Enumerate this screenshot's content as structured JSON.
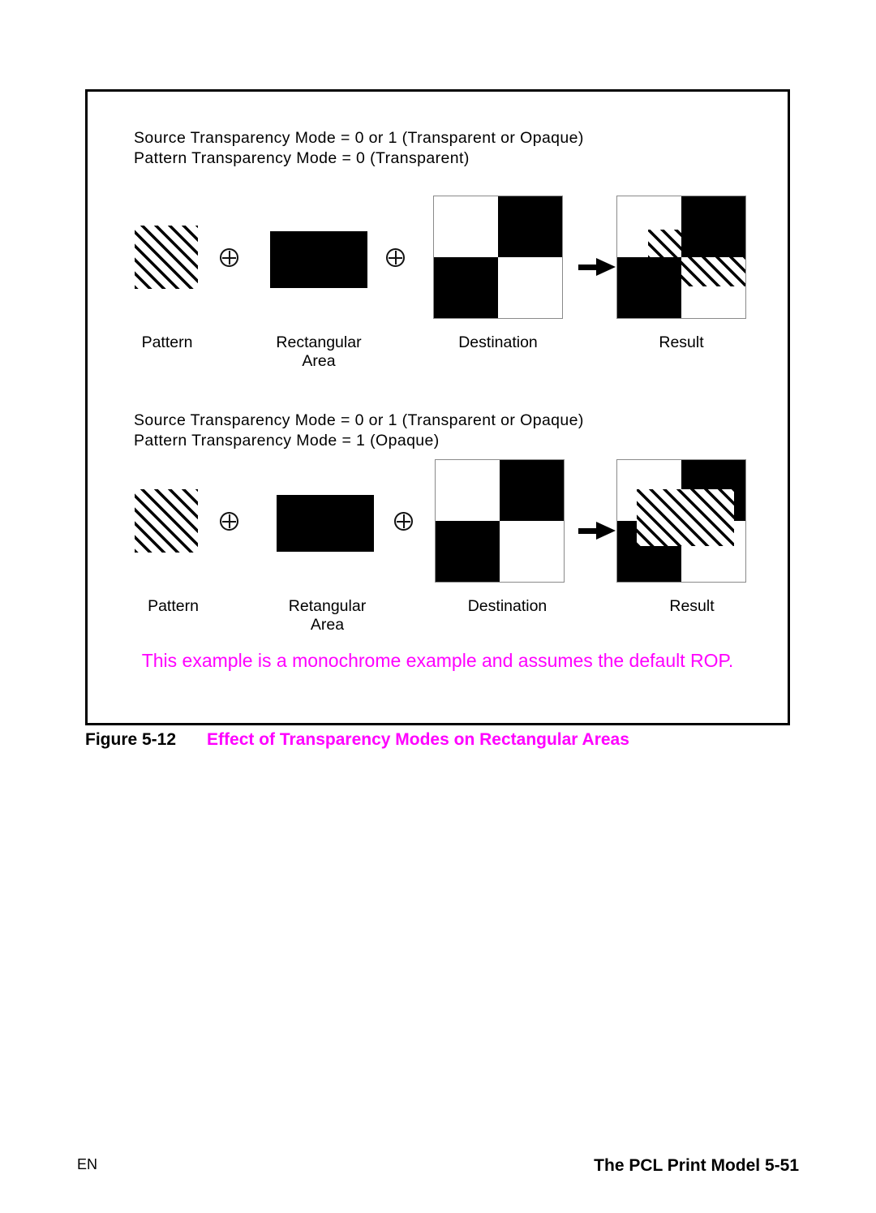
{
  "figure": {
    "panels": [
      {
        "id": "transparent-pattern",
        "mode_line_1": "Source Transparency Mode = 0 or 1 (Transparent or Opaque)",
        "mode_line_2": "Pattern Transparency Mode = 0 (Transparent)",
        "labels": {
          "pattern": "Pattern",
          "rectangular_area": "Rectangular\nArea",
          "destination": "Destination",
          "result": "Result"
        },
        "operators": [
          "plus-circle",
          "plus-circle",
          "arrow-right"
        ]
      },
      {
        "id": "opaque-pattern",
        "mode_line_1": "Source Transparency Mode = 0 or 1 (Transparent or Opaque)",
        "mode_line_2": "Pattern Transparency Mode = 1 (Opaque)",
        "labels": {
          "pattern": "Pattern",
          "rectangular_area": "Retangular\nArea",
          "destination": "Destination",
          "result": "Result"
        },
        "operators": [
          "plus-circle",
          "plus-circle",
          "arrow-right"
        ]
      }
    ],
    "note": "This example is a monochrome example and assumes the default ROP.",
    "caption_number": "Figure 5-12",
    "caption_title": "Effect of Transparency Modes on Rectangular Areas"
  },
  "footer": {
    "left": "EN",
    "right": "The PCL Print Model 5-51"
  },
  "colors": {
    "magenta": "#ff00ff",
    "black": "#000000",
    "white": "#ffffff",
    "frame_border": "#000000"
  },
  "graphics": {
    "pattern_fill": "45-degree-diagonal-hatch",
    "rectangular_area_fill": "solid-black",
    "destination_fill": "checkerboard-2x2",
    "checkerboard_quadrants": [
      "white",
      "black",
      "black",
      "white"
    ]
  }
}
